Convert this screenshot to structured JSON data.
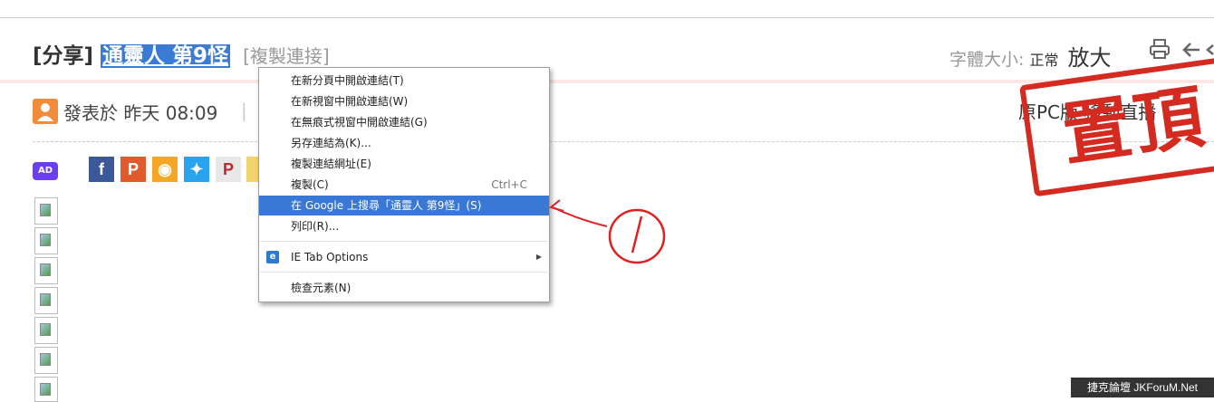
{
  "post": {
    "title_prefix": "[分享]",
    "title_selected": "通靈人 第9怪",
    "copy_link": "[複製連接]",
    "font_size_label": "字體大小:",
    "font_normal": "正常",
    "font_large": "放大",
    "posted": "發表於 昨天 08:09",
    "separator": "|",
    "right_info": "原PC版 移動直播",
    "ad_label": "AD"
  },
  "share_icons": [
    {
      "name": "facebook-share-icon",
      "glyph": "f",
      "color": "#3b5998"
    },
    {
      "name": "plurk-share-icon",
      "glyph": "P",
      "color": "#e05a2b"
    },
    {
      "name": "weibo-share-icon",
      "glyph": "◉",
      "color": "#f5a623"
    },
    {
      "name": "twitter-share-icon",
      "glyph": "✦",
      "color": "#2aa3ef"
    },
    {
      "name": "pinterest-share-icon",
      "glyph": "P",
      "color": "#e8e8e8"
    }
  ],
  "stamp": {
    "text": "置頂"
  },
  "context_menu": {
    "items": [
      {
        "label": "在新分頁中開啟連結(T)"
      },
      {
        "label": "在新視窗中開啟連結(W)"
      },
      {
        "label": "在無痕式視窗中開啟連結(G)"
      },
      {
        "label": "另存連結為(K)..."
      },
      {
        "label": "複製連結網址(E)"
      },
      {
        "label": "複製(C)",
        "shortcut": "Ctrl+C"
      },
      {
        "label": "在 Google 上搜尋「通靈人 第9怪」(S)",
        "highlighted": true
      },
      {
        "label": "列印(R)..."
      },
      {
        "label": "IE Tab Options"
      },
      {
        "label": "檢查元素(N)"
      }
    ]
  },
  "annotation": {
    "text": "1"
  },
  "watermark": "捷克論壇 JKForuM.Net"
}
